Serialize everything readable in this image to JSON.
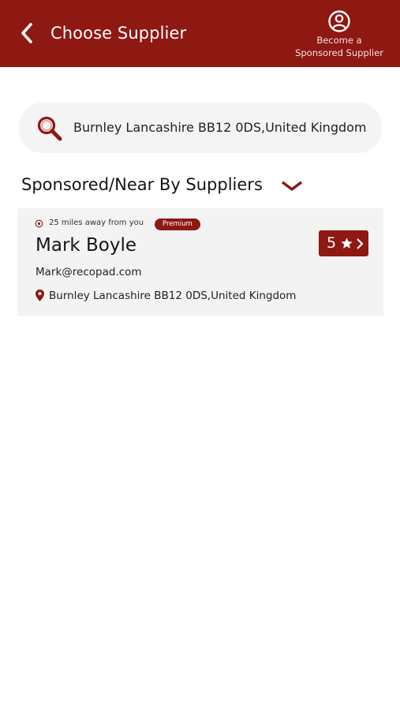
{
  "header": {
    "title": "Choose Supplier",
    "back_icon": "chevron-left-icon",
    "become_label": "Become a\nSponsored Supplier",
    "become_icon": "user-circle-icon"
  },
  "search": {
    "value": "Burnley Lancashire BB12 0DS,United Kingdom",
    "icon": "search-icon"
  },
  "section": {
    "title": "Sponsored/Near By Suppliers",
    "toggle_icon": "chevron-down-icon"
  },
  "suppliers": [
    {
      "distance": "25 miles away from you",
      "badge": "Premium",
      "name": "Mark Boyle",
      "rating": "5",
      "email": "Mark@recopad.com",
      "address": "Burnley Lancashire BB12 0DS,United Kingdom"
    }
  ],
  "colors": {
    "primary": "#8e1812",
    "card_bg": "#f4f3f3",
    "search_bg": "#f5f4f4"
  }
}
